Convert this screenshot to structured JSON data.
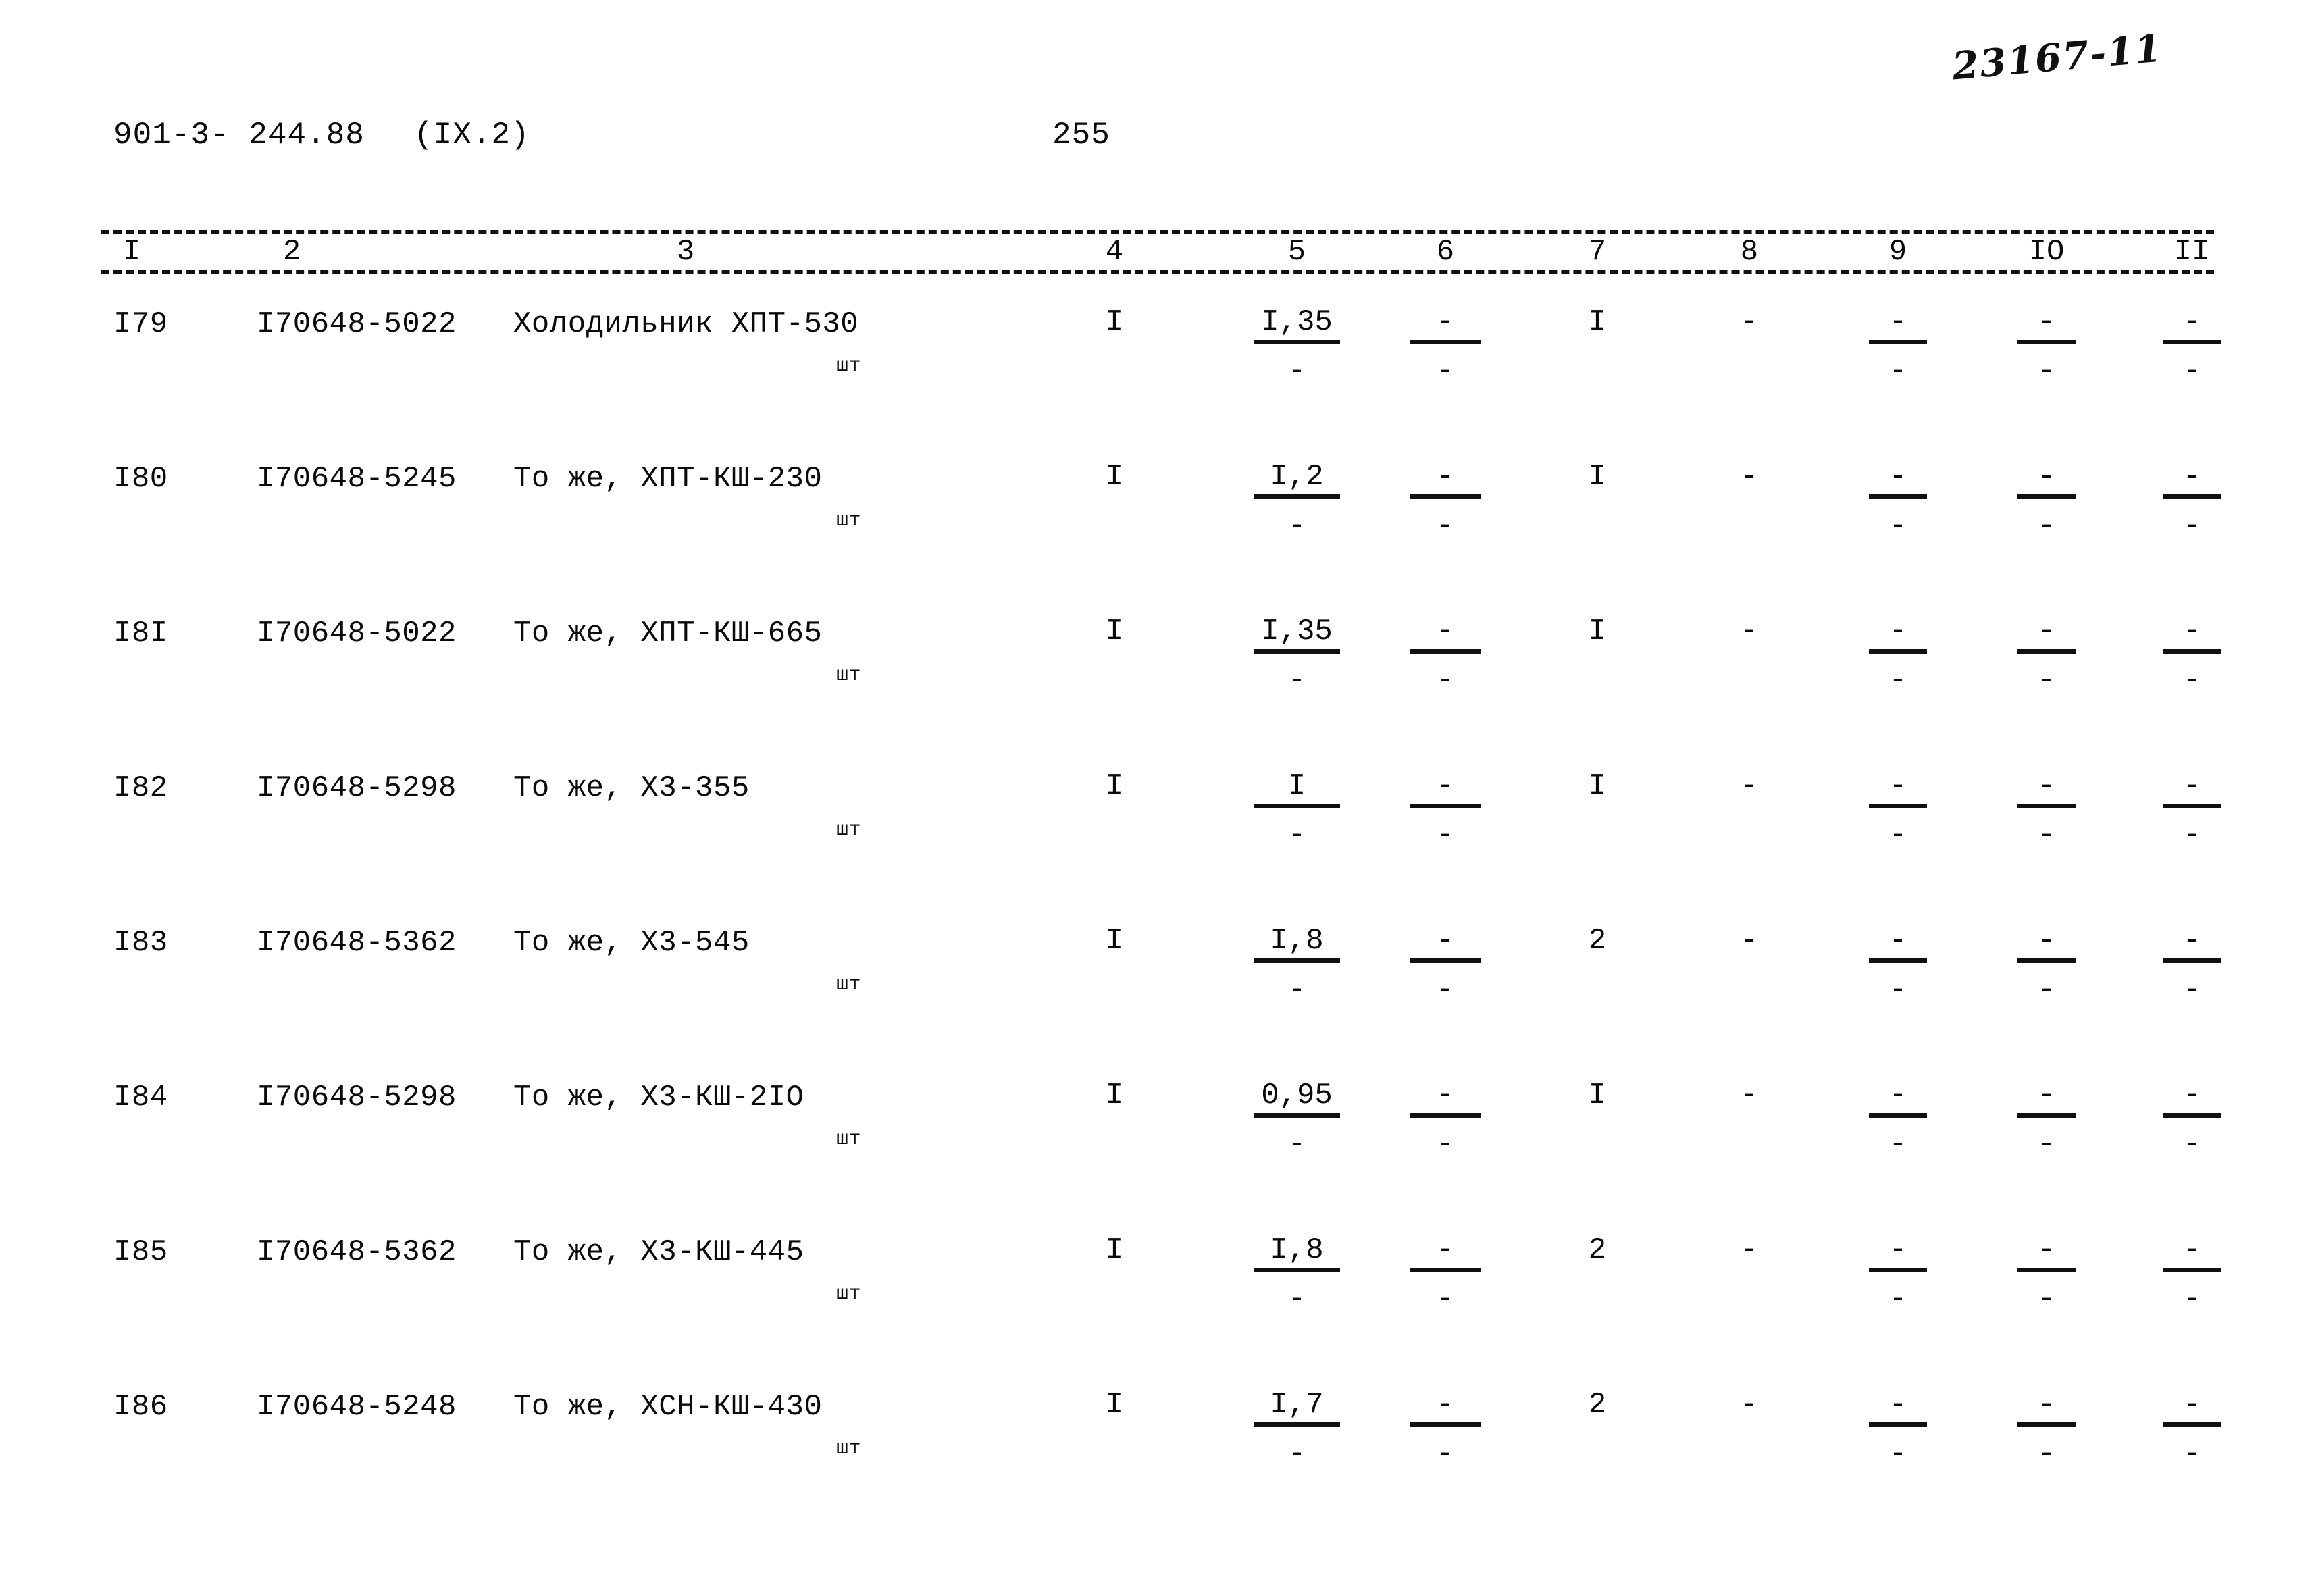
{
  "archive_mark": "23167-11",
  "header": {
    "doc_code": "901-3- 244.88",
    "section": "(IX.2)",
    "page_number": "255"
  },
  "table": {
    "column_headers": [
      "I",
      "2",
      "3",
      "4",
      "5",
      "6",
      "7",
      "8",
      "9",
      "IO",
      "II"
    ],
    "unit_label": "шт",
    "rows": [
      {
        "pos": "I79",
        "code": "I70648-5022",
        "name": "Холодильник ХПТ-530",
        "unit": "шт",
        "c4": "I",
        "c5_top": "I,35",
        "c5_bot": "-",
        "c6_top": "-",
        "c6_bot": "-",
        "c7": "I",
        "c8": "-",
        "c9_top": "-",
        "c9_bot": "-",
        "c10_top": "-",
        "c10_bot": "-",
        "c11_top": "-",
        "c11_bot": "-"
      },
      {
        "pos": "I80",
        "code": "I70648-5245",
        "name": "То же, ХПТ-КШ-230",
        "unit": "шт",
        "c4": "I",
        "c5_top": "I,2",
        "c5_bot": "-",
        "c6_top": "-",
        "c6_bot": "-",
        "c7": "I",
        "c8": "-",
        "c9_top": "-",
        "c9_bot": "-",
        "c10_top": "-",
        "c10_bot": "-",
        "c11_top": "-",
        "c11_bot": "-"
      },
      {
        "pos": "I8I",
        "code": "I70648-5022",
        "name": "То же, ХПТ-КШ-665",
        "unit": "шт",
        "c4": "I",
        "c5_top": "I,35",
        "c5_bot": "-",
        "c6_top": "-",
        "c6_bot": "-",
        "c7": "I",
        "c8": "-",
        "c9_top": "-",
        "c9_bot": "-",
        "c10_top": "-",
        "c10_bot": "-",
        "c11_top": "-",
        "c11_bot": "-"
      },
      {
        "pos": "I82",
        "code": "I70648-5298",
        "name": "То же, Х3-355",
        "unit": "шт",
        "c4": "I",
        "c5_top": "I",
        "c5_bot": "-",
        "c6_top": "-",
        "c6_bot": "-",
        "c7": "I",
        "c8": "-",
        "c9_top": "-",
        "c9_bot": "-",
        "c10_top": "-",
        "c10_bot": "-",
        "c11_top": "-",
        "c11_bot": "-"
      },
      {
        "pos": "I83",
        "code": "I70648-5362",
        "name": "То же, Х3-545",
        "unit": "шт",
        "c4": "I",
        "c5_top": "I,8",
        "c5_bot": "-",
        "c6_top": "-",
        "c6_bot": "-",
        "c7": "2",
        "c8": "-",
        "c9_top": "-",
        "c9_bot": "-",
        "c10_top": "-",
        "c10_bot": "-",
        "c11_top": "-",
        "c11_bot": "-"
      },
      {
        "pos": "I84",
        "code": "I70648-5298",
        "name": "То же, Х3-КШ-2IO",
        "unit": "шт",
        "c4": "I",
        "c5_top": "0,95",
        "c5_bot": "-",
        "c6_top": "-",
        "c6_bot": "-",
        "c7": "I",
        "c8": "-",
        "c9_top": "-",
        "c9_bot": "-",
        "c10_top": "-",
        "c10_bot": "-",
        "c11_top": "-",
        "c11_bot": "-"
      },
      {
        "pos": "I85",
        "code": "I70648-5362",
        "name": "То же, Х3-КШ-445",
        "unit": "шт",
        "c4": "I",
        "c5_top": "I,8",
        "c5_bot": "-",
        "c6_top": "-",
        "c6_bot": "-",
        "c7": "2",
        "c8": "-",
        "c9_top": "-",
        "c9_bot": "-",
        "c10_top": "-",
        "c10_bot": "-",
        "c11_top": "-",
        "c11_bot": "-"
      },
      {
        "pos": "I86",
        "code": "I70648-5248",
        "name": "То же, ХСН-КШ-430",
        "unit": "шт",
        "c4": "I",
        "c5_top": "I,7",
        "c5_bot": "-",
        "c6_top": "-",
        "c6_bot": "-",
        "c7": "2",
        "c8": "-",
        "c9_top": "-",
        "c9_bot": "-",
        "c10_top": "-",
        "c10_bot": "-",
        "c11_top": "-",
        "c11_bot": "-"
      }
    ]
  }
}
